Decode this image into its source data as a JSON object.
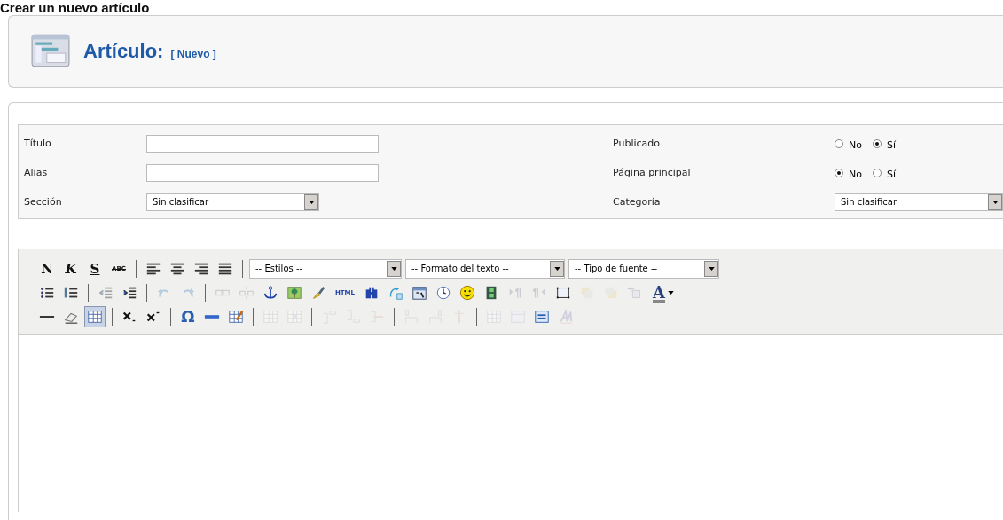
{
  "page_heading": "Crear un nuevo artículo",
  "header": {
    "title": "Artículo:",
    "subtitle": "[ Nuevo ]"
  },
  "form": {
    "left": [
      {
        "label": "Título",
        "kind": "text"
      },
      {
        "label": "Alias",
        "kind": "text"
      },
      {
        "label": "Sección",
        "kind": "select",
        "value": "Sin clasificar"
      }
    ],
    "right": [
      {
        "label": "Publicado",
        "kind": "radio",
        "options": [
          {
            "label": "No",
            "selected": false
          },
          {
            "label": "Sí",
            "selected": true
          }
        ]
      },
      {
        "label": "Página principal",
        "kind": "radio",
        "options": [
          {
            "label": "No",
            "selected": true
          },
          {
            "label": "Sí",
            "selected": false
          }
        ]
      },
      {
        "label": "Categoría",
        "kind": "select",
        "value": "Sin clasificar"
      }
    ]
  },
  "toolbar": [
    [
      {
        "kind": "bold",
        "label": "N",
        "disabled": false,
        "active": false
      },
      {
        "kind": "italic",
        "label": "K",
        "disabled": false,
        "active": false
      },
      {
        "kind": "underline",
        "label": "S",
        "disabled": false,
        "active": false
      },
      {
        "kind": "strike",
        "label": "ABC",
        "disabled": false,
        "active": false
      },
      {
        "kind": "sep"
      },
      {
        "kind": "align-left",
        "disabled": false,
        "active": false
      },
      {
        "kind": "align-center",
        "disabled": false,
        "active": false
      },
      {
        "kind": "align-right",
        "disabled": false,
        "active": false
      },
      {
        "kind": "justify",
        "disabled": false,
        "active": false
      },
      {
        "kind": "sep"
      },
      {
        "kind": "select",
        "label": "-- Estilos --",
        "disabled": false
      },
      {
        "kind": "select",
        "label": "-- Formato del texto --",
        "disabled": false
      },
      {
        "kind": "select",
        "label": "-- Tipo de fuente --",
        "disabled": false
      }
    ],
    [
      {
        "kind": "bullets",
        "disabled": false,
        "active": false
      },
      {
        "kind": "numbers",
        "disabled": false,
        "active": false
      },
      {
        "kind": "sep"
      },
      {
        "kind": "outdent",
        "disabled": true,
        "active": false
      },
      {
        "kind": "indent",
        "disabled": false,
        "active": false
      },
      {
        "kind": "sep"
      },
      {
        "kind": "undo",
        "disabled": true,
        "active": false
      },
      {
        "kind": "redo",
        "disabled": true,
        "active": false
      },
      {
        "kind": "sep"
      },
      {
        "kind": "link",
        "disabled": true,
        "active": false
      },
      {
        "kind": "unlink",
        "disabled": true,
        "active": false
      },
      {
        "kind": "anchor",
        "disabled": false,
        "active": false
      },
      {
        "kind": "image",
        "disabled": false,
        "active": false
      },
      {
        "kind": "brush",
        "disabled": false,
        "active": false
      },
      {
        "kind": "html",
        "label": "HTML",
        "disabled": false,
        "active": false
      },
      {
        "kind": "find",
        "disabled": false,
        "active": false
      },
      {
        "kind": "replace",
        "disabled": false,
        "active": false
      },
      {
        "kind": "calendar",
        "disabled": false,
        "active": false
      },
      {
        "kind": "clock",
        "disabled": false,
        "active": false
      },
      {
        "kind": "smiley",
        "disabled": false,
        "active": false
      },
      {
        "kind": "film",
        "disabled": false,
        "active": false
      },
      {
        "kind": "ltr",
        "disabled": true,
        "active": false
      },
      {
        "kind": "rtl",
        "disabled": true,
        "active": false
      },
      {
        "kind": "layer",
        "disabled": false,
        "active": false
      },
      {
        "kind": "forward",
        "disabled": true,
        "active": false
      },
      {
        "kind": "backward",
        "disabled": true,
        "active": false
      },
      {
        "kind": "absolute",
        "disabled": true,
        "active": false
      },
      {
        "kind": "font-color",
        "label": "A",
        "disabled": false,
        "active": false
      }
    ],
    [
      {
        "kind": "hr",
        "disabled": false,
        "active": false
      },
      {
        "kind": "eraser",
        "disabled": false,
        "active": false
      },
      {
        "kind": "table",
        "disabled": false,
        "active": true
      },
      {
        "kind": "sep"
      },
      {
        "kind": "subscript",
        "disabled": false,
        "active": false
      },
      {
        "kind": "superscript",
        "disabled": false,
        "active": false
      },
      {
        "kind": "sep"
      },
      {
        "kind": "charmap",
        "label": "Ω",
        "disabled": false,
        "active": false
      },
      {
        "kind": "rule",
        "disabled": false,
        "active": false
      },
      {
        "kind": "edit-table",
        "disabled": false,
        "active": false
      },
      {
        "kind": "sep"
      },
      {
        "kind": "row-props",
        "disabled": true,
        "active": false
      },
      {
        "kind": "cell-props",
        "disabled": true,
        "active": false
      },
      {
        "kind": "sep"
      },
      {
        "kind": "row-before",
        "disabled": true,
        "active": false
      },
      {
        "kind": "row-after",
        "disabled": true,
        "active": false
      },
      {
        "kind": "row-delete",
        "disabled": true,
        "active": false
      },
      {
        "kind": "sep"
      },
      {
        "kind": "col-before",
        "disabled": true,
        "active": false
      },
      {
        "kind": "col-after",
        "disabled": true,
        "active": false
      },
      {
        "kind": "col-delete",
        "disabled": true,
        "active": false
      },
      {
        "kind": "sep"
      },
      {
        "kind": "split",
        "disabled": true,
        "active": false
      },
      {
        "kind": "merge",
        "disabled": true,
        "active": false
      },
      {
        "kind": "visual-box",
        "disabled": false,
        "active": false
      },
      {
        "kind": "visual-aid",
        "disabled": true,
        "active": false
      }
    ]
  ]
}
